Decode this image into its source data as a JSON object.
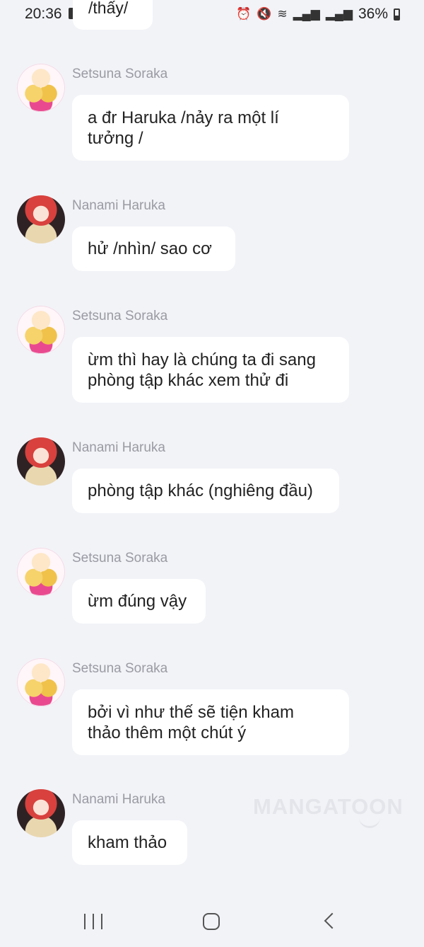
{
  "status_bar": {
    "time": "20:36",
    "battery": "36%"
  },
  "previous_message_fragment": "/thấy/",
  "messages": [
    {
      "sender": "Setsuna Soraka",
      "avatar": "setsuna-avatar",
      "text": "a đr Haruka /nảy ra một lí\ntưởng /"
    },
    {
      "sender": "Nanami Haruka",
      "avatar": "nanami-avatar",
      "text": "hử /nhìn/ sao cơ"
    },
    {
      "sender": "Setsuna Soraka",
      "avatar": "setsuna-avatar",
      "text": "ừm thì hay là chúng ta đi sang\nphòng tập khác xem thử đi"
    },
    {
      "sender": "Nanami Haruka",
      "avatar": "nanami-avatar",
      "text": "phòng tập khác (nghiêng đầu)"
    },
    {
      "sender": "Setsuna Soraka",
      "avatar": "setsuna-avatar",
      "text": "ừm đúng vậy"
    },
    {
      "sender": "Setsuna Soraka",
      "avatar": "setsuna-avatar",
      "text": "bởi vì như thế sẽ tiện kham\nthảo thêm một chút ý"
    },
    {
      "sender": "Nanami Haruka",
      "avatar": "nanami-avatar",
      "text": "kham thảo"
    }
  ],
  "watermark": "MANGATOON",
  "nav": {
    "recents_icon": "recents-icon",
    "home_icon": "home-icon",
    "back_icon": "back-icon"
  }
}
